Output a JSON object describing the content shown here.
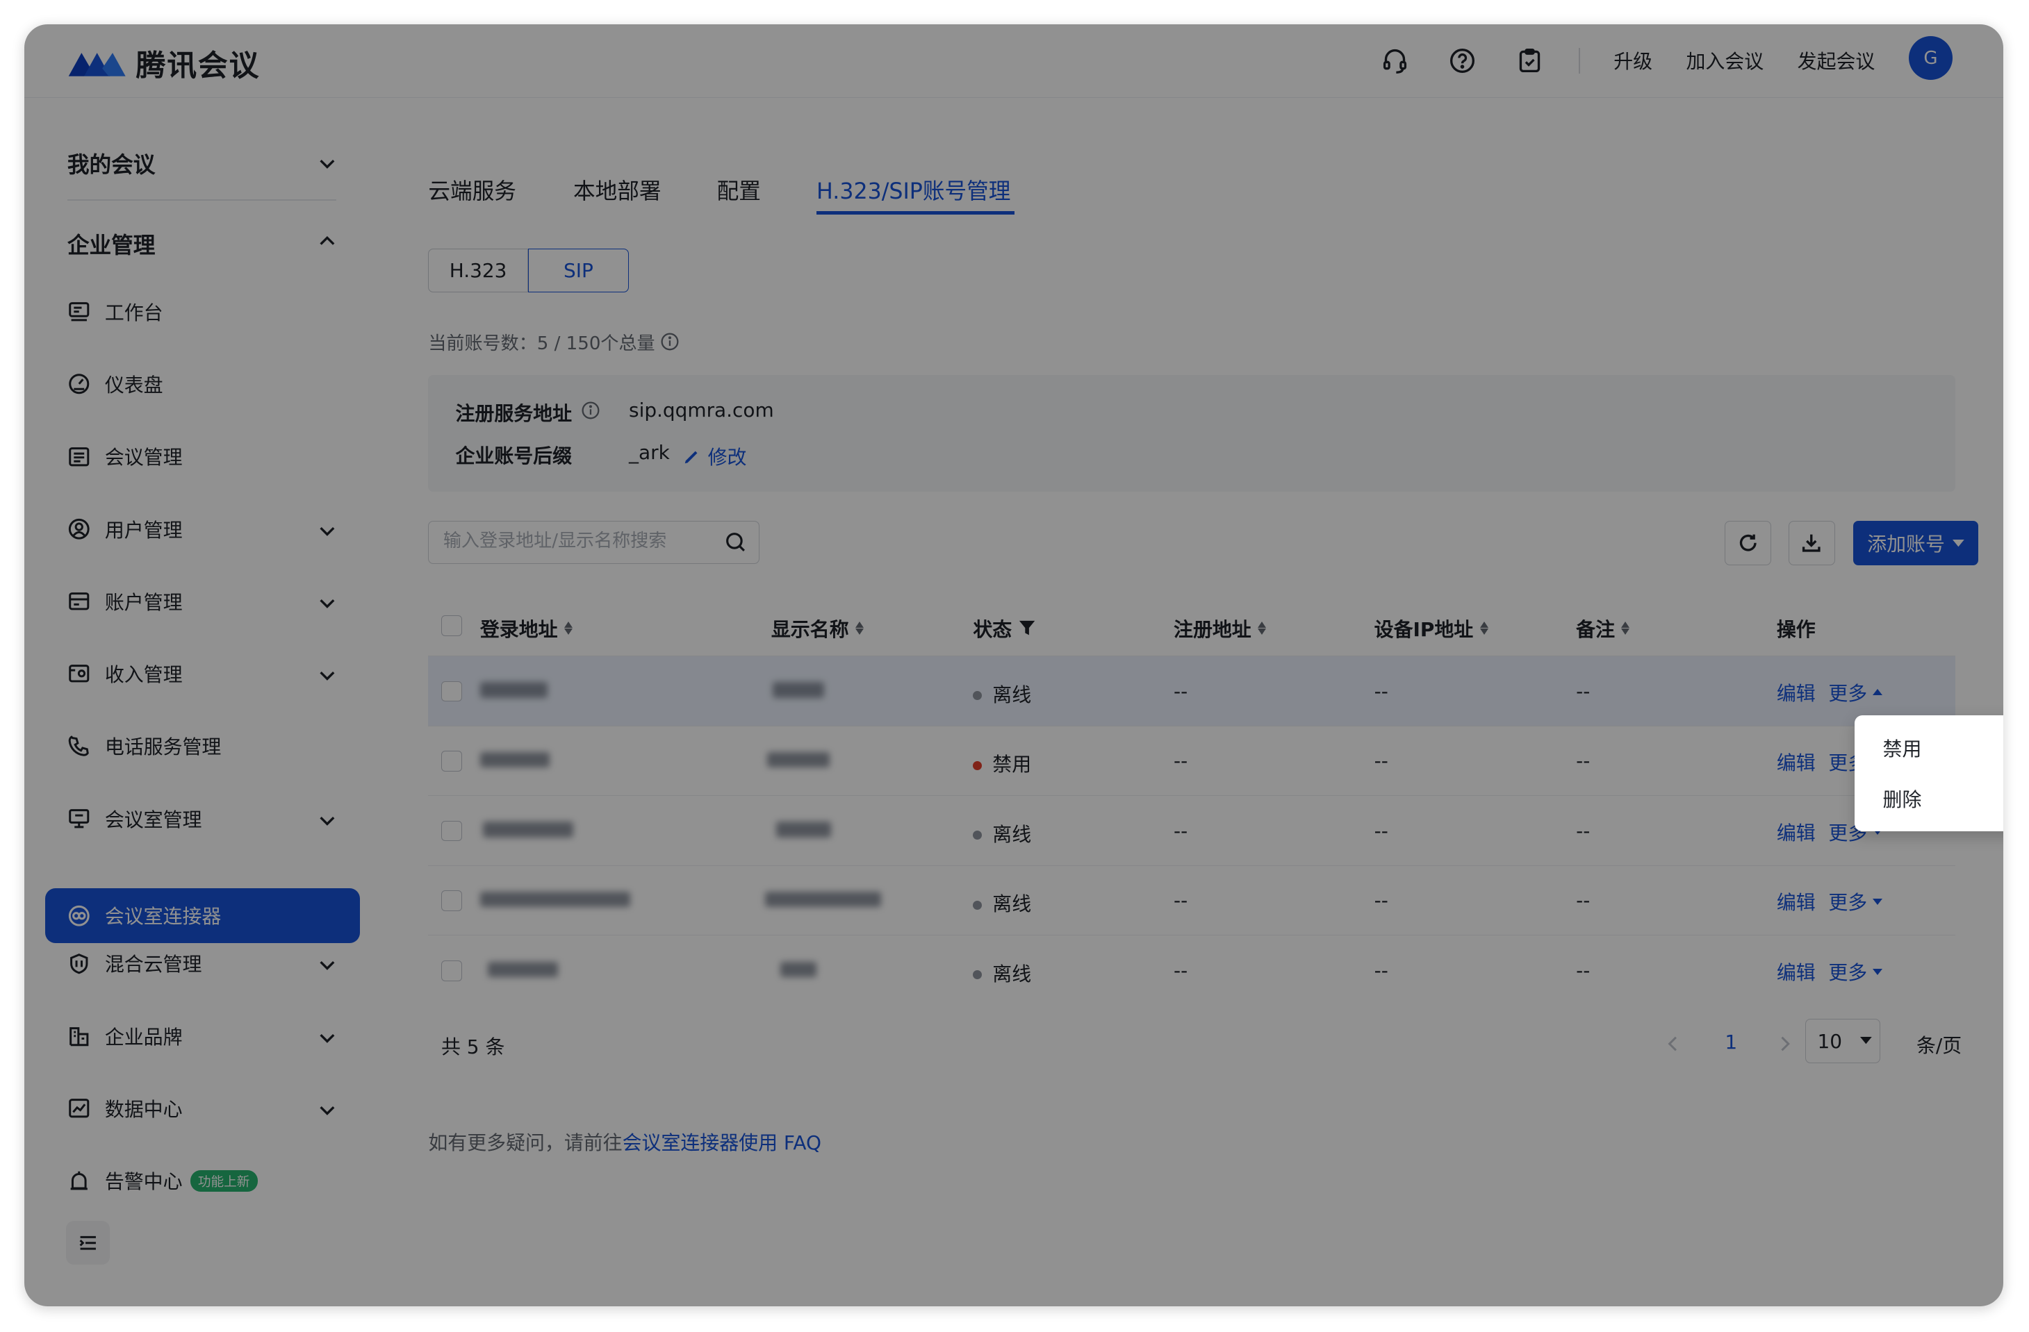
{
  "app": {
    "title": "腾讯会议",
    "avatar_letter": "G",
    "brand_color": "#1754d8"
  },
  "header": {
    "links": [
      "升级",
      "加入会议",
      "发起会议"
    ],
    "icons": [
      "headset-icon",
      "help-icon",
      "clipboard-check-icon"
    ]
  },
  "sidebar": {
    "groups": [
      {
        "label": "我的会议",
        "expanded": false
      },
      {
        "label": "企业管理",
        "expanded": true
      }
    ],
    "items": [
      {
        "label": "工作台",
        "icon": "workbench-icon",
        "has_children": false
      },
      {
        "label": "仪表盘",
        "icon": "dashboard-icon",
        "has_children": false
      },
      {
        "label": "会议管理",
        "icon": "meeting-list-icon",
        "has_children": false
      },
      {
        "label": "用户管理",
        "icon": "user-icon",
        "has_children": true
      },
      {
        "label": "账户管理",
        "icon": "account-icon",
        "has_children": true
      },
      {
        "label": "收入管理",
        "icon": "income-icon",
        "has_children": true
      },
      {
        "label": "电话服务管理",
        "icon": "phone-icon",
        "has_children": false
      },
      {
        "label": "会议室管理",
        "icon": "room-icon",
        "has_children": true
      },
      {
        "label": "会议室连接器",
        "icon": "connector-icon",
        "has_children": false,
        "active": true
      },
      {
        "label": "混合云管理",
        "icon": "hybrid-cloud-icon",
        "has_children": true
      },
      {
        "label": "企业品牌",
        "icon": "brand-icon",
        "has_children": true
      },
      {
        "label": "数据中心",
        "icon": "data-center-icon",
        "has_children": true
      },
      {
        "label": "告警中心",
        "icon": "alarm-icon",
        "has_children": false,
        "badge": "功能上新"
      }
    ]
  },
  "tabs": [
    {
      "label": "云端服务"
    },
    {
      "label": "本地部署"
    },
    {
      "label": "配置"
    },
    {
      "label": "H.323/SIP账号管理",
      "active": true
    }
  ],
  "segments": {
    "left": "H.323",
    "right": "SIP",
    "selected": "SIP"
  },
  "account_count": "当前账号数：5 / 150个总量",
  "info": {
    "reg_label": "注册服务地址",
    "reg_value": "sip.qqmra.com",
    "suffix_label": "企业账号后缀",
    "suffix_value": "_ark",
    "edit_label": "修改"
  },
  "search": {
    "placeholder": "输入登录地址/显示名称搜索"
  },
  "add_button": "添加账号",
  "table": {
    "columns": [
      "登录地址",
      "显示名称",
      "状态",
      "注册地址",
      "设备IP地址",
      "备注",
      "操作"
    ],
    "rows": [
      {
        "status": "离线",
        "status_color": "#8f959e",
        "reg": "--",
        "ip": "--",
        "note": "--",
        "edit": "编辑",
        "more": "更多"
      },
      {
        "status": "禁用",
        "status_color": "#e23e2b",
        "reg": "--",
        "ip": "--",
        "note": "--",
        "edit": "编辑",
        "more": "更多"
      },
      {
        "status": "离线",
        "status_color": "#8f959e",
        "reg": "--",
        "ip": "--",
        "note": "--",
        "edit": "编辑",
        "more": "更多"
      },
      {
        "status": "离线",
        "status_color": "#8f959e",
        "reg": "--",
        "ip": "--",
        "note": "--",
        "edit": "编辑",
        "more": "更多"
      },
      {
        "status": "离线",
        "status_color": "#8f959e",
        "reg": "--",
        "ip": "--",
        "note": "--",
        "edit": "编辑",
        "more": "更多"
      }
    ]
  },
  "pagination": {
    "total": "共 5 条",
    "current_page": "1",
    "page_size": "10",
    "per_page_label": "条/页"
  },
  "faq": {
    "prefix": "如有更多疑问，请前往",
    "link": "会议室连接器使用 FAQ"
  },
  "dropdown": {
    "items": [
      "禁用",
      "删除"
    ],
    "highlighted": "删除"
  }
}
